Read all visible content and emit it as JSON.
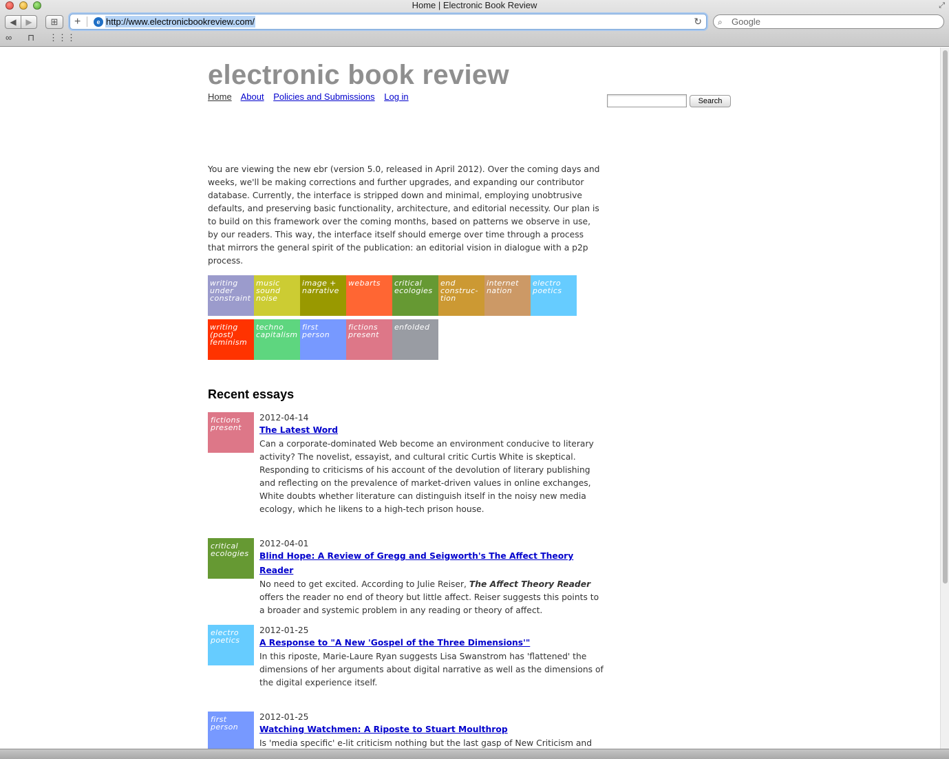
{
  "window": {
    "title": "Home | Electronic Book Review"
  },
  "toolbar": {
    "back_symbol": "◀",
    "forward_symbol": "▶",
    "bookmark_symbol": "⊞",
    "url": "http://www.electronicbookreview.com/",
    "add_symbol": "+",
    "reload_symbol": "↻",
    "search_placeholder": "Google",
    "search_symbol": "⌕",
    "bookmarks_bar": {
      "reading_list_symbol": "∞",
      "book_symbol": "⊓",
      "grid_symbol": "⋮⋮⋮"
    }
  },
  "site": {
    "title": "electronic book review",
    "nav": [
      "Home",
      "About",
      "Policies and Submissions",
      "Log in"
    ],
    "search_button": "Search",
    "intro": "You are viewing the new ebr (version 5.0, released in April 2012). Over the coming days and weeks, we'll be making corrections and further upgrades, and expanding our contributor database. Currently, the interface is stripped down and minimal, employing unobtrusive defaults, and preserving basic functionality, architecture, and editorial necessity.  Our plan is to build on this framework over the coming months, based on patterns we observe in use, by our readers. This way, the interface itself should emerge over time through a process that mirrors the general spirit of the publication: an editorial vision in dialogue with a p2p process."
  },
  "threads": [
    {
      "label": "writing under constraint",
      "color": "#9b9bcc"
    },
    {
      "label": "music sound noise",
      "color": "#cccc33"
    },
    {
      "label": "image + narrative",
      "color": "#999900"
    },
    {
      "label": "webarts",
      "color": "#ff6633"
    },
    {
      "label": "critical ecologies",
      "color": "#669933"
    },
    {
      "label": "end construc-tion",
      "color": "#cc9933"
    },
    {
      "label": "internet nation",
      "color": "#cc9966"
    },
    {
      "label": "electro poetics",
      "color": "#66ccff"
    },
    {
      "label": "writing (post) feminism",
      "color": "#ff3300"
    },
    {
      "label": "techno capitalism",
      "color": "#5ed67f"
    },
    {
      "label": "first person",
      "color": "#7799ff"
    },
    {
      "label": "fictions present",
      "color": "#dd7788"
    },
    {
      "label": "enfolded",
      "color": "#999ca3"
    }
  ],
  "recent": {
    "heading": "Recent essays",
    "essays": [
      {
        "thread": "fictions present",
        "color": "#dd7788",
        "date": "2012-04-14",
        "title": "The Latest Word",
        "summary": "Can a corporate-dominated Web become an environment conducive to literary activity? The novelist, essayist, and cultural critic Curtis White is skeptical. Responding to criticisms of his account of the devolution of literary publishing and reflecting on the prevalence of market-driven values in online exchanges, White doubts whether literature can distinguish itself in the noisy new media ecology, which he likens to a high-tech prison house."
      },
      {
        "thread": "critical ecologies",
        "color": "#669933",
        "date": "2012-04-01",
        "title": "Blind Hope: A Review of Gregg and Seigworth's The Affect Theory Reader",
        "summary_before": "No need to get excited. According to Julie Reiser, ",
        "summary_em": "The Affect Theory Reader",
        "summary_after": " offers the reader no end of theory but little affect. Reiser suggests this points to a broader and systemic problem in any reading or theory of affect."
      },
      {
        "thread": "electro poetics",
        "color": "#66ccff",
        "date": "2012-01-25",
        "title": "A Response to \"A New 'Gospel of the Three Dimensions'\"",
        "summary": "In this riposte, Marie-Laure Ryan suggests Lisa Swanstrom has 'flattened' the dimensions of her arguments about digital narrative as well as the dimensions of the digital experience itself."
      },
      {
        "thread": "first person",
        "color": "#7799ff",
        "date": "2012-01-25",
        "title": "Watching Watchmen: A Riposte to Stuart Moulthrop",
        "summary": "Is 'media specific' e-lit criticism nothing but the last gasp of New Criticism and"
      }
    ]
  }
}
